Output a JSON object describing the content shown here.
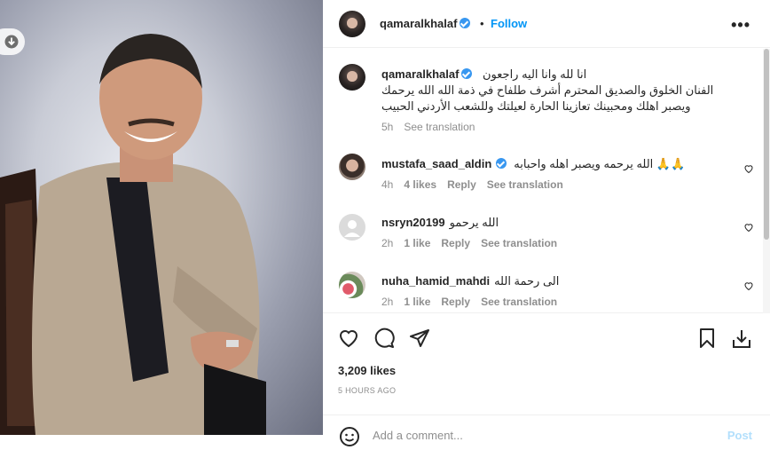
{
  "post": {
    "username": "qamaralkhalaf",
    "dot": "•",
    "follow_label": "Follow",
    "more_label": "•••",
    "caption_line1": "انا لله وانا اليه راجعون",
    "caption_line2": "الفنان الخلوق والصديق المحترم أشرف طلفاح في ذمة الله الله يرحمك",
    "caption_line3": "ويصبر اهلك ومحبينك تعازينا الحارة لعيلتك وللشعب الأردني الحبيب",
    "caption_time": "5h",
    "caption_translate": "See translation"
  },
  "comments": [
    {
      "username": "mustafa_saad_aldin",
      "verified": true,
      "text": "الله يرحمه ويصبر اهله واحبابه 🙏🙏",
      "time": "4h",
      "likes": "4 likes",
      "reply": "Reply",
      "translate": "See translation"
    },
    {
      "username": "nsryn20199",
      "verified": false,
      "text": "الله يرحمو",
      "time": "2h",
      "likes": "1 like",
      "reply": "Reply",
      "translate": "See translation"
    },
    {
      "username": "nuha_hamid_mahdi",
      "verified": false,
      "text": "الى رحمة الله",
      "time": "2h",
      "likes": "1 like",
      "reply": "Reply",
      "translate": "See translation"
    }
  ],
  "stats": {
    "likes": "3,209 likes",
    "date": "5 HOURS AGO"
  },
  "comment_box": {
    "placeholder": "Add a comment...",
    "post_label": "Post"
  },
  "icons": [
    "download-icon",
    "heart-icon",
    "comment-icon",
    "share-icon",
    "bookmark-icon",
    "zoom-icon",
    "emoji-icon",
    "verified-icon",
    "more-icon"
  ],
  "colors": {
    "accent": "#0095f6",
    "verified": "#3897f0",
    "muted": "#8e8e8e",
    "post_disabled": "#b2dffc"
  }
}
